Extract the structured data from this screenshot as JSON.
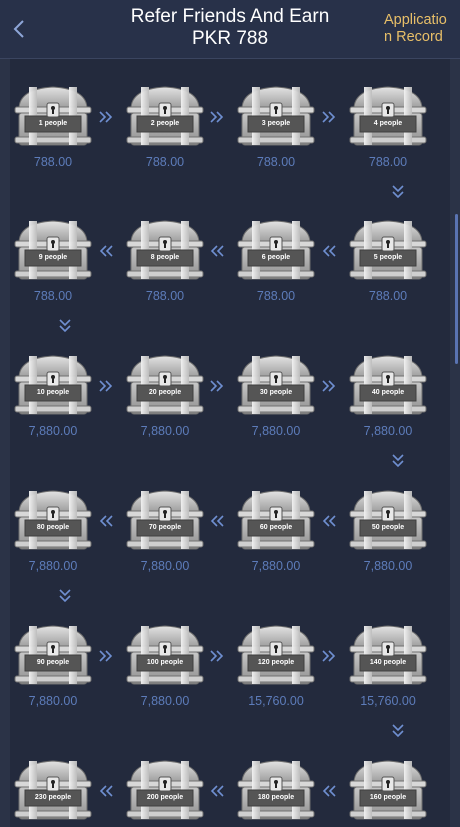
{
  "header": {
    "title_line1": "Refer Friends And Earn",
    "title_line2": "PKR 788",
    "record_label": "Application Record"
  },
  "rewards": [
    {
      "people": "1 people",
      "amount": "788.00"
    },
    {
      "people": "2 people",
      "amount": "788.00"
    },
    {
      "people": "3 people",
      "amount": "788.00"
    },
    {
      "people": "4 people",
      "amount": "788.00"
    },
    {
      "people": "5 people",
      "amount": "788.00"
    },
    {
      "people": "6 people",
      "amount": "788.00"
    },
    {
      "people": "8 people",
      "amount": "788.00"
    },
    {
      "people": "9 people",
      "amount": "788.00"
    },
    {
      "people": "10 people",
      "amount": "7,880.00"
    },
    {
      "people": "20 people",
      "amount": "7,880.00"
    },
    {
      "people": "30 people",
      "amount": "7,880.00"
    },
    {
      "people": "40 people",
      "amount": "7,880.00"
    },
    {
      "people": "50 people",
      "amount": "7,880.00"
    },
    {
      "people": "60 people",
      "amount": "7,880.00"
    },
    {
      "people": "70 people",
      "amount": "7,880.00"
    },
    {
      "people": "80 people",
      "amount": "7,880.00"
    },
    {
      "people": "90 people",
      "amount": "7,880.00"
    },
    {
      "people": "100 people",
      "amount": "7,880.00"
    },
    {
      "people": "120 people",
      "amount": "15,760.00"
    },
    {
      "people": "140 people",
      "amount": "15,760.00"
    },
    {
      "people": "160 people",
      "amount": ""
    },
    {
      "people": "180 people",
      "amount": ""
    },
    {
      "people": "200 people",
      "amount": ""
    },
    {
      "people": "230 people",
      "amount": ""
    }
  ],
  "icons": {
    "back": "chevron-left-icon",
    "chest": "treasure-chest-icon",
    "arrow_right": "double-chevron-right-icon",
    "arrow_left": "double-chevron-left-icon",
    "arrow_down": "double-chevron-down-icon"
  },
  "colors": {
    "background": "#232a3d",
    "header": "#283149",
    "accent": "#e8bf68",
    "amount": "#5d7cba"
  }
}
